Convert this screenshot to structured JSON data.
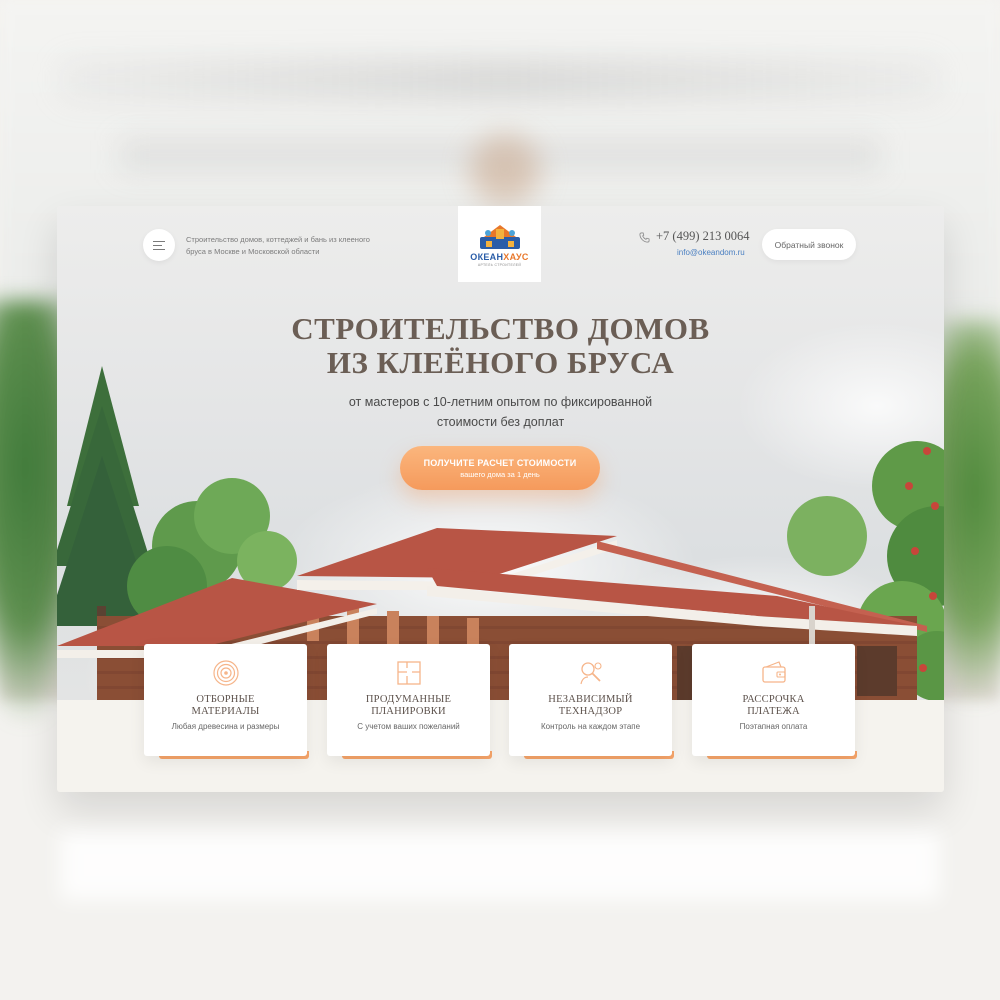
{
  "header": {
    "tagline": "Строительство домов, коттеджей и бань из клееного бруса в Москве и Московской области",
    "logo_word_1": "ОКЕАН",
    "logo_word_2": "ХАУС",
    "logo_sub": "АРТЕЛЬ СТРОИТЕЛЕЙ",
    "phone": "+7 (499) 213 0064",
    "email": "info@okeandom.ru",
    "callback_label": "Обратный звонок"
  },
  "hero": {
    "title_line_1": "Строительство домов",
    "title_line_2": "из клеёного бруса",
    "subtitle_line_1": "от мастеров с 10-летним опытом по фиксированной",
    "subtitle_line_2": "стоимости без доплат",
    "cta_main": "ПОЛУЧИТЕ РАСЧЕТ СТОИМОСТИ",
    "cta_sub": "вашего дома за 1 день"
  },
  "features": [
    {
      "icon": "wood-rings-icon",
      "title_line_1": "Отборные",
      "title_line_2": "материалы",
      "text": "Любая древесина и размеры"
    },
    {
      "icon": "floor-plan-icon",
      "title_line_1": "Продуманные",
      "title_line_2": "планировки",
      "text": "С учетом ваших пожеланий"
    },
    {
      "icon": "inspector-icon",
      "title_line_1": "Независимый",
      "title_line_2": "технадзор",
      "text": "Контроль на каждом этапе"
    },
    {
      "icon": "wallet-icon",
      "title_line_1": "Рассрочка",
      "title_line_2": "платежа",
      "text": "Поэтапная оплата"
    }
  ],
  "colors": {
    "accent": "#f59a5c",
    "title": "#6b5e55",
    "link": "#4a7fc1",
    "logo_blue": "#2a5da8",
    "logo_orange": "#e8772a"
  }
}
